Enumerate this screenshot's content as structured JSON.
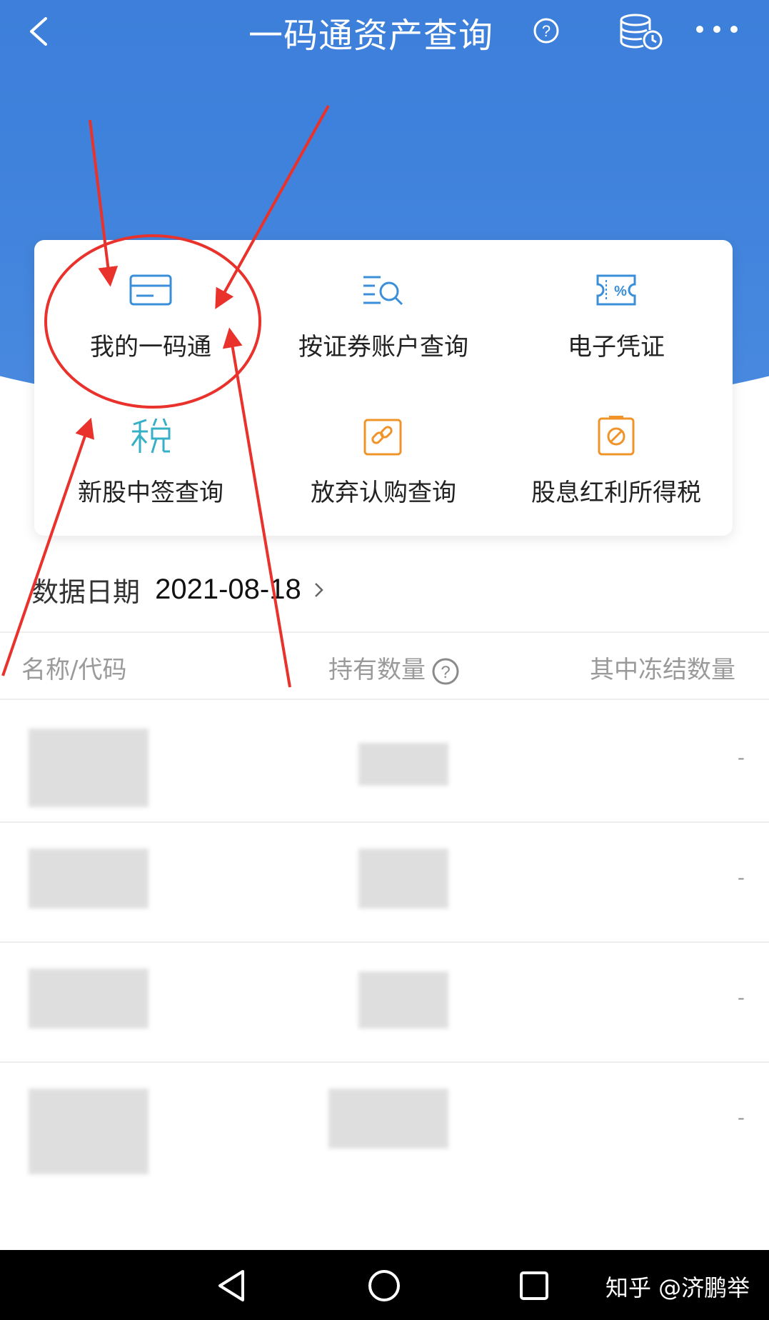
{
  "header": {
    "title": "一码通资产查询",
    "help_glyph": "?",
    "accent_color": "#3a7bd8"
  },
  "features": [
    {
      "label": "我的一码通",
      "icon": "card-icon"
    },
    {
      "label": "按证券账户查询",
      "icon": "list-search-icon"
    },
    {
      "label": "电子凭证",
      "icon": "percent-ticket-icon"
    },
    {
      "label": "新股中签查询",
      "icon": "tax-character-icon"
    },
    {
      "label": "放弃认购查询",
      "icon": "link-edit-icon"
    },
    {
      "label": "股息红利所得税",
      "icon": "forbidden-doc-icon"
    }
  ],
  "data_date": {
    "label": "数据日期",
    "value": "2021-08-18"
  },
  "table": {
    "columns": [
      "名称/代码",
      "持有数量",
      "其中冻结数量"
    ],
    "help_glyph": "?",
    "rows": [
      {
        "frozen": "-"
      },
      {
        "frozen": "-"
      },
      {
        "frozen": "-"
      },
      {
        "frozen": "-"
      }
    ]
  },
  "watermark": "知乎 @济鹏举"
}
